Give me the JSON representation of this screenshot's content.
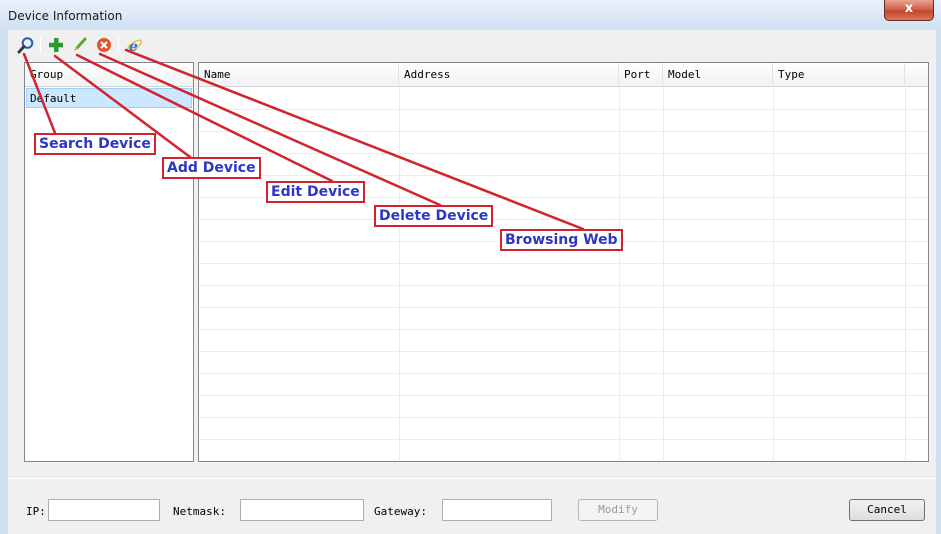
{
  "window": {
    "title": "Device Information",
    "close_glyph": "x"
  },
  "toolbar": {
    "buttons": [
      {
        "name": "search",
        "icon": "magnifier-icon"
      },
      {
        "name": "add",
        "icon": "plus-icon"
      },
      {
        "name": "edit",
        "icon": "pencil-icon"
      },
      {
        "name": "delete",
        "icon": "delete-icon"
      },
      {
        "name": "web",
        "icon": "ie-browser-icon"
      }
    ]
  },
  "group_panel": {
    "header": "Group",
    "items": [
      "Default"
    ]
  },
  "device_table": {
    "columns": [
      "Name",
      "Address",
      "Port",
      "Model",
      "Type"
    ],
    "rows": []
  },
  "bottom": {
    "ip_label": "IP:",
    "ip_value": "",
    "netmask_label": "Netmask:",
    "netmask_value": "",
    "gateway_label": "Gateway:",
    "gateway_value": "",
    "modify_label": "Modify",
    "cancel_label": "Cancel"
  },
  "annotations": {
    "search": "Search Device",
    "add": "Add Device",
    "edit": "Edit Device",
    "delete": "Delete Device",
    "web": "Browsing Web"
  },
  "colors": {
    "callout_border": "#d1242f",
    "callout_text": "#2e36c4",
    "selection": "#cce8ff"
  }
}
